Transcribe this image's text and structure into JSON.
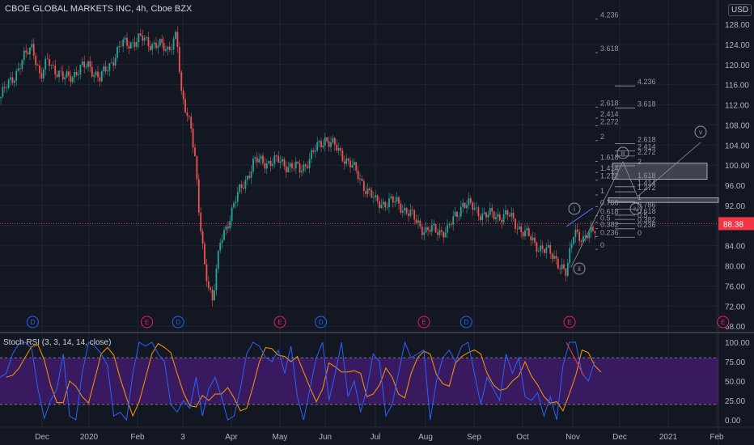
{
  "header": {
    "title": "CBOE GLOBAL MARKETS INC, 4h, Cboe BZX",
    "currency": "USD"
  },
  "colors": {
    "up": "#26a69a",
    "down": "#ef5350",
    "k_line": "#2962ff",
    "d_line": "#ff9800",
    "band": "#4a1c7a",
    "current_price": "#f23645"
  },
  "chart_data": {
    "type": "candlestick",
    "price_axis": {
      "ticks": [
        "128.00",
        "124.00",
        "120.00",
        "116.00",
        "112.00",
        "108.00",
        "104.00",
        "100.00",
        "96.00",
        "92.00",
        "88.00",
        "84.00",
        "80.00",
        "76.00",
        "72.00",
        "68.00"
      ],
      "ylim": [
        67,
        131
      ]
    },
    "time_axis": {
      "ticks": [
        "Dec",
        "2020",
        "Feb",
        "3",
        "Apr",
        "May",
        "Jun",
        "Jul",
        "Aug",
        "Sep",
        "Oct",
        "Nov",
        "Dec",
        "2021",
        "Feb"
      ]
    },
    "current_price": "88.38",
    "price_path": [
      [
        "2019-11-05",
        113.8
      ],
      [
        "2019-11-25",
        124
      ],
      [
        "2019-11-30",
        117
      ],
      [
        "2019-12-05",
        121
      ],
      [
        "2019-12-15",
        117
      ],
      [
        "2020-01-01",
        120
      ],
      [
        "2020-01-08",
        117
      ],
      [
        "2020-01-22",
        124
      ],
      [
        "2020-02-04",
        125
      ],
      [
        "2020-02-20",
        123
      ],
      [
        "2020-02-26",
        126
      ],
      [
        "2020-02-29",
        113.5
      ],
      [
        "2020-03-06",
        108.7
      ],
      [
        "2020-03-09",
        100.7
      ],
      [
        "2020-03-11",
        91
      ],
      [
        "2020-03-15",
        79.8
      ],
      [
        "2020-03-20",
        73.3
      ],
      [
        "2020-03-25",
        84.6
      ],
      [
        "2020-04-03",
        92.6
      ],
      [
        "2020-04-15",
        100.7
      ],
      [
        "2020-05-01",
        100.7
      ],
      [
        "2020-05-15",
        99
      ],
      [
        "2020-06-01",
        105.5
      ],
      [
        "2020-06-15",
        100.7
      ],
      [
        "2020-07-01",
        92.6
      ],
      [
        "2020-07-15",
        92.6
      ],
      [
        "2020-08-01",
        87
      ],
      [
        "2020-08-15",
        87
      ],
      [
        "2020-08-25",
        92.6
      ],
      [
        "2020-09-08",
        90
      ],
      [
        "2020-09-22",
        90
      ],
      [
        "2020-10-08",
        84.6
      ],
      [
        "2020-10-22",
        81.4
      ],
      [
        "2020-10-28",
        78.1
      ],
      [
        "2020-11-02",
        87.8
      ],
      [
        "2020-11-08",
        84.6
      ],
      [
        "2020-11-16",
        88.38
      ]
    ],
    "fib_extensions": [
      {
        "level_0": 83.6,
        "level_1": 94.4,
        "labels": [
          "4.236",
          "3.618",
          "2.618",
          "2.414",
          "2.272",
          "2",
          "1.618",
          "1.414",
          "1.272",
          "1",
          "0.786",
          "0.618",
          "0.5",
          "0.382",
          "0.236",
          "0"
        ]
      },
      {
        "level_0": 86.0,
        "level_1": 93.1,
        "labels": [
          "4.236",
          "3.618",
          "2.618",
          "2.414",
          "2.272",
          "2",
          "1.618",
          "1.414",
          "1.272",
          "1",
          "0.786",
          "0.618",
          "0.5",
          "0.382",
          "0.236",
          "0"
        ]
      }
    ],
    "zones": [
      {
        "from": 97.2,
        "to": 100.4
      },
      {
        "from": 92.6,
        "to": 93.5
      }
    ],
    "elliott_waves": [
      "i",
      "ii",
      "iii",
      "iv",
      "v"
    ],
    "events": [
      {
        "type": "D",
        "date": "2019-11-25"
      },
      {
        "type": "E",
        "date": "2020-02-07"
      },
      {
        "type": "D",
        "date": "2020-02-27"
      },
      {
        "type": "E",
        "date": "2020-05-01"
      },
      {
        "type": "D",
        "date": "2020-05-29"
      },
      {
        "type": "E",
        "date": "2020-07-31"
      },
      {
        "type": "D",
        "date": "2020-08-27"
      },
      {
        "type": "E",
        "date": "2020-10-30"
      },
      {
        "type": "E",
        "date": "2021-02-05"
      }
    ],
    "stoch_rsi": {
      "title": "Stoch RSI (3, 3, 14, 14, close)",
      "ticks": [
        "100.00",
        "75.00",
        "50.00",
        "25.00",
        "0.00"
      ],
      "upper_band": 80,
      "lower_band": 20,
      "k": [
        55,
        60,
        85,
        98,
        100,
        92,
        40,
        2,
        25,
        40,
        85,
        5,
        0,
        60,
        100,
        95,
        85,
        70,
        5,
        10,
        0,
        60,
        100,
        95,
        100,
        85,
        75,
        20,
        10,
        25,
        15,
        55,
        5,
        40,
        55,
        30,
        0,
        5,
        40,
        85,
        100,
        95,
        80,
        75,
        90,
        60,
        95,
        30,
        0,
        40,
        80,
        100,
        25,
        60,
        100,
        30,
        50,
        10,
        40,
        85,
        75,
        5,
        20,
        60,
        100,
        80,
        85,
        90,
        0,
        50,
        80,
        90,
        75,
        95,
        100,
        60,
        20,
        55,
        40,
        25,
        85,
        60,
        80,
        30,
        25,
        35,
        5,
        30,
        0,
        70,
        100,
        100,
        60,
        50,
        75
      ]
    }
  }
}
